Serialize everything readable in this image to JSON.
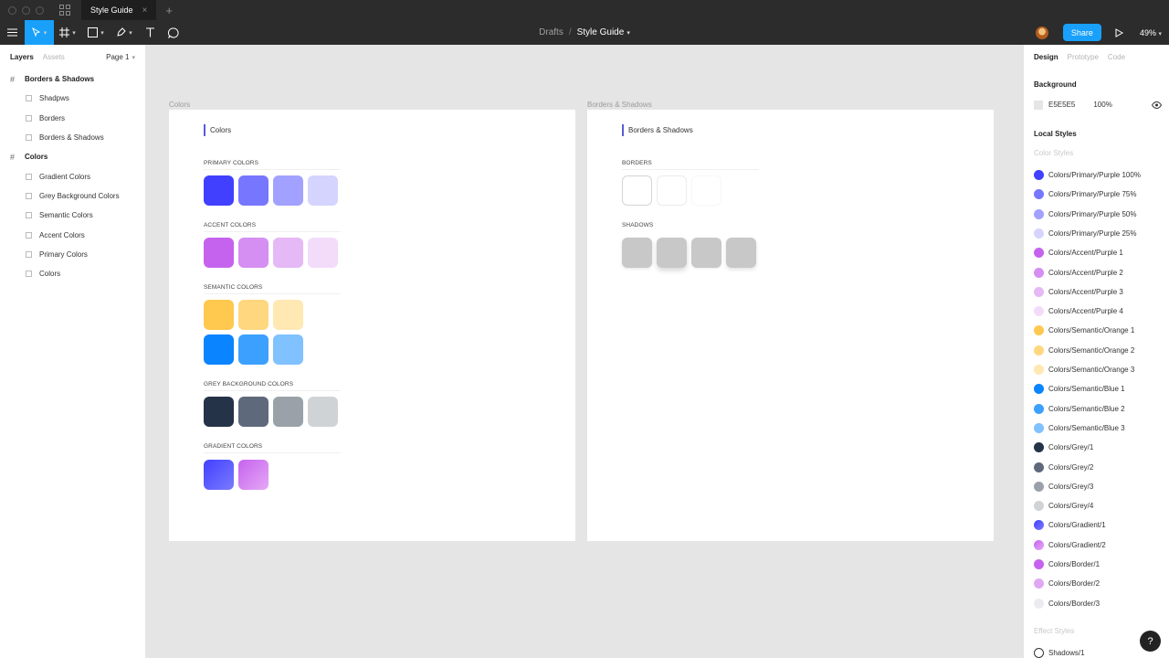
{
  "titlebar": {
    "tab_title": "Style Guide",
    "tab_close": "×",
    "new_tab": "+"
  },
  "toolbar": {
    "breadcrumb_parent": "Drafts",
    "breadcrumb_sep": "/",
    "file_name": "Style Guide",
    "share_label": "Share",
    "zoom_label": "49%",
    "accent_color": "#18a0fb"
  },
  "left_panel": {
    "tab_layers": "Layers",
    "tab_assets": "Assets",
    "page_label": "Page 1",
    "layers": [
      {
        "type": "frame",
        "name": "Borders & Shadows"
      },
      {
        "type": "child",
        "name": "Shadpws"
      },
      {
        "type": "child",
        "name": "Borders"
      },
      {
        "type": "child",
        "name": "Borders & Shadows"
      },
      {
        "type": "frame",
        "name": "Colors"
      },
      {
        "type": "child",
        "name": "Gradient Colors"
      },
      {
        "type": "child",
        "name": "Grey Background Colors"
      },
      {
        "type": "child",
        "name": "Semantic Colors"
      },
      {
        "type": "child",
        "name": "Accent Colors"
      },
      {
        "type": "child",
        "name": "Primary Colors"
      },
      {
        "type": "child",
        "name": "Colors"
      }
    ]
  },
  "canvas": {
    "colors_frame": {
      "label": "Colors",
      "heading": "Colors",
      "primary_label": "PRIMARY COLORS",
      "accent_label": "ACCENT COLORS",
      "semantic_label": "SEMANTIC COLORS",
      "grey_label": "GREY BACKGROUND COLORS",
      "gradient_label": "GRADIENT COLORS",
      "primary": [
        "#4140ff",
        "#7776ff",
        "#a2a1ff",
        "#d5d4ff"
      ],
      "accent": [
        "#c563ee",
        "#d58ef2",
        "#e5b8f6",
        "#f2dcfa"
      ],
      "semantic_orange": [
        "#ffc84f",
        "#ffd77f",
        "#ffe8b2"
      ],
      "semantic_blue": [
        "#0a84ff",
        "#3ca0ff",
        "#80c1ff"
      ],
      "grey": [
        "#253348",
        "#5e6a7b",
        "#9aa1a9",
        "#d0d3d6"
      ]
    },
    "borders_frame": {
      "label": "Borders & Shadows",
      "heading": "Borders & Shadows",
      "borders_label": "BORDERS",
      "shadows_label": "SHADOWS"
    }
  },
  "right_panel": {
    "tab_design": "Design",
    "tab_prototype": "Prototype",
    "tab_code": "Code",
    "background_heading": "Background",
    "background_hex": "E5E5E5",
    "background_opacity": "100%",
    "local_styles_heading": "Local Styles",
    "color_styles_label": "Color Styles",
    "effect_styles_label": "Effect Styles",
    "color_styles": [
      {
        "name": "Colors/Primary/Purple 100%",
        "color": "#4140ff"
      },
      {
        "name": "Colors/Primary/Purple 75%",
        "color": "#7776ff"
      },
      {
        "name": "Colors/Primary/Purple 50%",
        "color": "#a2a1ff"
      },
      {
        "name": "Colors/Primary/Purple 25%",
        "color": "#d5d4ff"
      },
      {
        "name": "Colors/Accent/Purple 1",
        "color": "#c563ee"
      },
      {
        "name": "Colors/Accent/Purple 2",
        "color": "#d58ef2"
      },
      {
        "name": "Colors/Accent/Purple 3",
        "color": "#e5b8f6"
      },
      {
        "name": "Colors/Accent/Purple 4",
        "color": "#f2dcfa"
      },
      {
        "name": "Colors/Semantic/Orange 1",
        "color": "#ffc84f"
      },
      {
        "name": "Colors/Semantic/Orange 2",
        "color": "#ffd77f"
      },
      {
        "name": "Colors/Semantic/Orange 3",
        "color": "#ffe8b2"
      },
      {
        "name": "Colors/Semantic/Blue 1",
        "color": "#0a84ff"
      },
      {
        "name": "Colors/Semantic/Blue 2",
        "color": "#3ca0ff"
      },
      {
        "name": "Colors/Semantic/Blue 3",
        "color": "#80c1ff"
      },
      {
        "name": "Colors/Grey/1",
        "color": "#253348"
      },
      {
        "name": "Colors/Grey/2",
        "color": "#5e6a7b"
      },
      {
        "name": "Colors/Grey/3",
        "color": "#9aa1a9"
      },
      {
        "name": "Colors/Grey/4",
        "color": "#d0d3d6"
      },
      {
        "name": "Colors/Gradient/1",
        "color": "#5b5bf0"
      },
      {
        "name": "Colors/Gradient/2",
        "color": "#d07ff0"
      },
      {
        "name": "Colors/Border/1",
        "color": "#c563ee"
      },
      {
        "name": "Colors/Border/2",
        "color": "#e0a8f3"
      },
      {
        "name": "Colors/Border/3",
        "color": "#ececf0"
      }
    ],
    "effect_styles": [
      {
        "name": "Shadows/1"
      }
    ]
  },
  "help_label": "?"
}
